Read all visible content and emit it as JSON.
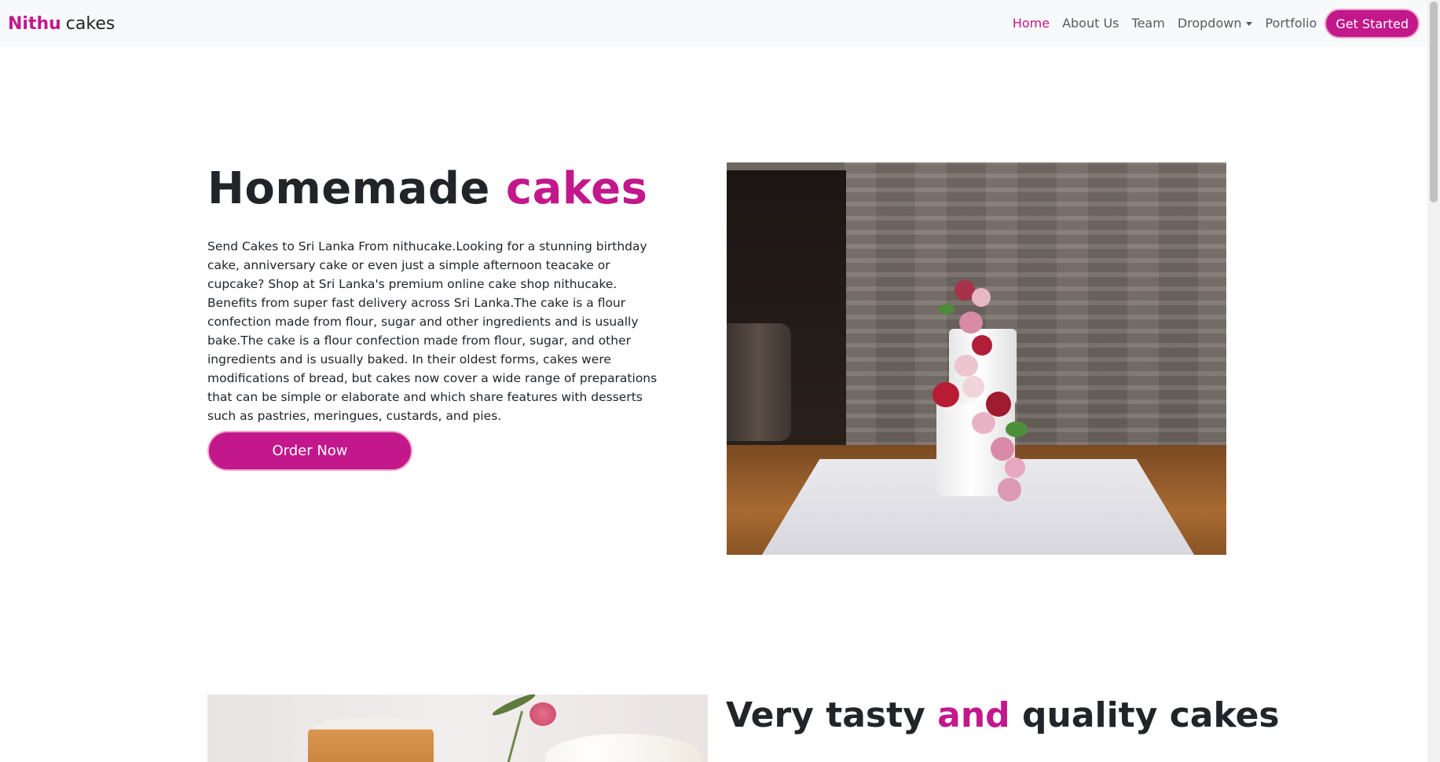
{
  "navbar": {
    "brand_primary": "Nithu",
    "brand_secondary": "cakes",
    "links": [
      {
        "label": "Home",
        "active": true
      },
      {
        "label": "About Us"
      },
      {
        "label": "Team"
      },
      {
        "label": "Dropdown"
      },
      {
        "label": "Portfolio"
      }
    ],
    "cta_label": "Get Started"
  },
  "hero": {
    "title_main": "Homemade",
    "title_accent": "cakes",
    "body": "Send Cakes to Sri Lanka From nithucake.Looking for a stunning birthday cake, anniversary cake or even just a simple afternoon teacake or cupcake? Shop at Sri Lanka's premium online cake shop nithucake. Benefits from super fast delivery across Sri Lanka.The cake is a flour confection made from flour, sugar and other ingredients and is usually bake.The cake is a flour confection made from flour, sugar, and other ingredients and is usually baked. In their oldest forms, cakes were modifications of bread, but cakes now cover a wide range of preparations that can be simple or elaborate and which share features with desserts such as pastries, meringues, custards, and pies.",
    "order_label": "Order Now"
  },
  "section2": {
    "title_part1": "Very tasty",
    "title_accent": "and",
    "title_part2": "quality cakes"
  },
  "colors": {
    "accent": "#c2188b",
    "navbar_bg": "#f8f9fa",
    "text": "#212529"
  },
  "icons": {
    "dropdown": "chevron-down-icon"
  }
}
